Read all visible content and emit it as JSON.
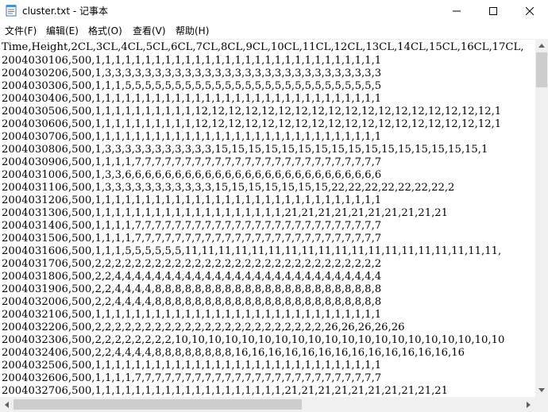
{
  "window": {
    "title": "cluster.txt - 记事本",
    "menu": [
      "文件(F)",
      "编辑(E)",
      "格式(O)",
      "查看(V)",
      "帮助(H)"
    ]
  },
  "editor": {
    "lines": [
      "Time,Height,2CL,3CL,4CL,5CL,6CL,7CL,8CL,9CL,10CL,11CL,12CL,13CL,14CL,15CL,16CL,17CL,",
      "2004030106,500,1,1,1,1,1,1,1,1,1,1,1,1,1,1,1,1,1,1,1,1,1,1,1,1,1,1,1,1,1",
      "2004030206,500,1,3,3,3,3,3,3,3,3,3,3,3,3,3,3,3,3,3,3,3,3,3,3,3,3,3,3,3,3",
      "2004030306,500,1,1,1,5,5,5,5,5,5,5,5,5,5,5,5,5,5,5,5,5,5,5,5,5,5,5,5,5,5",
      "2004030406,500,1,1,1,1,1,1,1,1,1,1,1,1,1,1,1,1,1,1,1,1,1,1,1,1,1,1,1,1,1",
      "2004030506,500,1,1,1,1,1,1,1,1,1,1,12,12,12,12,12,12,12,12,12,12,12,12,12,12,12,12,12,12,1",
      "2004030606,500,1,1,1,1,1,1,1,1,1,1,12,12,12,12,12,12,12,12,12,12,12,12,12,12,12,12,12,12,1",
      "2004030706,500,1,1,1,1,1,1,1,1,1,1,1,1,1,1,1,1,1,1,1,1,1,1,1,1,1,1,1,1,1",
      "2004030806,500,1,3,3,3,3,3,3,3,3,3,3,3,15,15,15,15,15,15,15,15,15,15,15,15,15,15,15,15,1",
      "2004030906,500,1,1,1,1,7,7,7,7,7,7,7,7,7,7,7,7,7,7,7,7,7,7,7,7,7,7,7,7,7",
      "2004031006,500,1,3,3,6,6,6,6,6,6,6,6,6,6,6,6,6,6,6,6,6,6,6,6,6,6,6,6,6,6",
      "2004031106,500,1,3,3,3,3,3,3,3,3,3,3,3,15,15,15,15,15,15,15,22,22,22,22,22,22,22,2",
      "2004031206,500,1,1,1,1,1,1,1,1,1,1,1,1,1,1,1,1,1,1,1,1,1,1,1,1,1,1,1,1,1",
      "2004031306,500,1,1,1,1,1,1,1,1,1,1,1,1,1,1,1,1,1,1,1,21,21,21,21,21,21,21,21,21,21",
      "2004031406,500,1,1,1,1,7,7,7,7,7,7,7,7,7,7,7,7,7,7,7,7,7,7,7,7,7,7,7,7,7",
      "2004031506,500,1,1,1,1,7,7,7,7,7,7,7,7,7,7,7,7,7,7,7,7,7,7,7,7,7,7,7,7,7",
      "2004031606,500,1,1,1,5,5,5,5,5,5,11,11,11,11,11,11,11,11,11,11,11,11,11,11,11,11,11,11,11,",
      "2004031706,500,2,2,2,2,2,2,2,2,2,2,2,2,2,2,2,2,2,2,2,2,2,2,2,2,2,2,2,2,2",
      "2004031806,500,2,2,4,4,4,4,4,4,4,4,4,4,4,4,4,4,4,4,4,4,4,4,4,4,4,4,4,4,4",
      "2004031906,500,2,2,4,4,4,4,8,8,8,8,8,8,8,8,8,8,8,8,8,8,8,8,8,8,8,8,8,8,8",
      "2004032006,500,2,2,4,4,4,4,8,8,8,8,8,8,8,8,8,8,8,8,8,8,8,8,8,8,8,8,8,8,8",
      "2004032106,500,1,1,1,1,1,1,1,1,1,1,1,1,1,1,1,1,1,1,1,1,1,1,1,1,1,1,1,1,1",
      "2004032206,500,2,2,2,2,2,2,2,2,2,2,2,2,2,2,2,2,2,2,2,2,2,2,2,26,26,26,26,26",
      "2004032306,500,2,2,2,2,2,2,2,2,10,10,10,10,10,10,10,10,10,10,10,10,10,10,10,10,10,10,10,10",
      "2004032406,500,2,2,4,4,4,4,8,8,8,8,8,8,8,8,16,16,16,16,16,16,16,16,16,16,16,16,16,16",
      "2004032506,500,1,1,1,1,1,1,1,1,1,1,1,1,1,1,1,1,1,1,1,1,1,1,1,1,1,1,1,1,1",
      "2004032606,500,1,1,1,1,7,7,7,7,7,7,7,7,7,7,7,7,7,7,7,7,7,7,7,7,7,7,7,7,7",
      "2004032706,500,1,1,1,1,1,1,1,1,1,1,1,1,1,1,1,1,1,1,1,21,21,21,21,21,21,21,21,21,21"
    ]
  },
  "icons": {
    "app": "notepad-icon",
    "minimize": "minimize-icon",
    "maximize": "maximize-icon",
    "close": "close-icon"
  }
}
